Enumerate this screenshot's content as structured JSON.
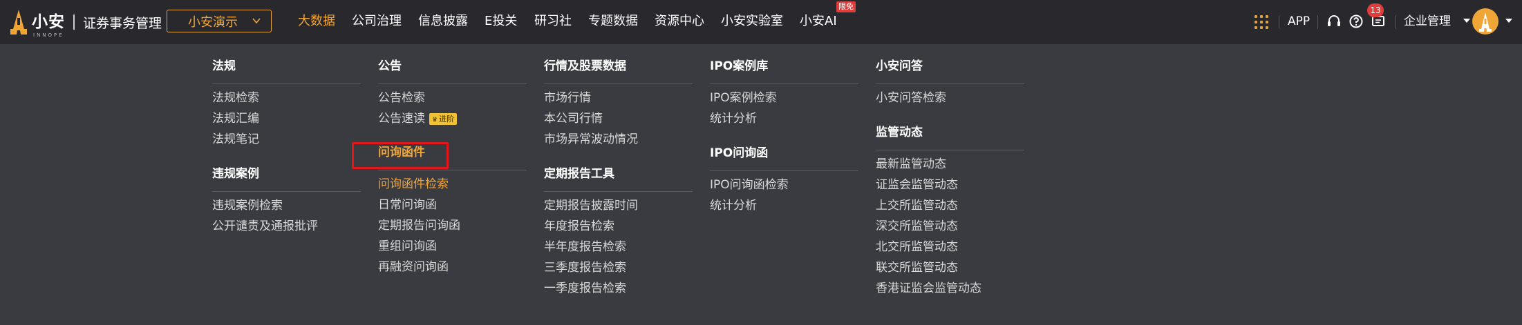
{
  "brand": {
    "name": "小安",
    "sub": "INNOPE",
    "system": "证券事务管理"
  },
  "org_select": {
    "value": "小安演示"
  },
  "nav": {
    "items": [
      {
        "label": "大数据"
      },
      {
        "label": "公司治理"
      },
      {
        "label": "信息披露"
      },
      {
        "label": "E投关"
      },
      {
        "label": "研习社"
      },
      {
        "label": "专题数据"
      },
      {
        "label": "资源中心"
      },
      {
        "label": "小安实验室"
      },
      {
        "label": "小安AI",
        "badge": "限免"
      }
    ],
    "active": "大数据"
  },
  "toolbar": {
    "app": "APP",
    "message_count": "13",
    "enterprise": "企业管理",
    "icons": [
      "apps-grid-icon",
      "headset-icon",
      "help-icon",
      "message-icon",
      "avatar-icon"
    ]
  },
  "menu": {
    "col1": {
      "s1_title": "法规",
      "s1_links": [
        "法规检索",
        "法规汇编",
        "法规笔记"
      ],
      "s2_title": "违规案例",
      "s2_links": [
        "违规案例检索",
        "公开谴责及通报批评"
      ]
    },
    "col2": {
      "s1_title": "公告",
      "s1_links": [
        "公告检索",
        "公告速读"
      ],
      "s1_tag": "进阶",
      "s2_title": "问询函件",
      "s2_links": [
        "问询函件检索",
        "日常问询函",
        "定期报告问询函",
        "重组问询函",
        "再融资问询函"
      ]
    },
    "col3": {
      "s1_title": "行情及股票数据",
      "s1_links": [
        "市场行情",
        "本公司行情",
        "市场异常波动情况"
      ],
      "s2_title": "定期报告工具",
      "s2_links": [
        "定期报告披露时间",
        "年度报告检索",
        "半年度报告检索",
        "三季度报告检索",
        "一季度报告检索"
      ]
    },
    "col4": {
      "s1_title": "IPO案例库",
      "s1_links": [
        "IPO案例检索",
        "统计分析"
      ],
      "s2_title": "IPO问询函",
      "s2_links": [
        "IPO问询函检索",
        "统计分析"
      ]
    },
    "col5": {
      "s1_title": "小安问答",
      "s1_links": [
        "小安问答检索"
      ],
      "s2_title": "监管动态",
      "s2_links": [
        "最新监管动态",
        "证监会监管动态",
        "上交所监管动态",
        "深交所监管动态",
        "北交所监管动态",
        "联交所监管动态",
        "香港证监会监管动态"
      ]
    }
  },
  "colors": {
    "accent": "#f0a537",
    "topbar": "#29292d",
    "panel": "#3a3b40",
    "highlight_box": "#e4161b",
    "badge": "#e03c3c"
  }
}
